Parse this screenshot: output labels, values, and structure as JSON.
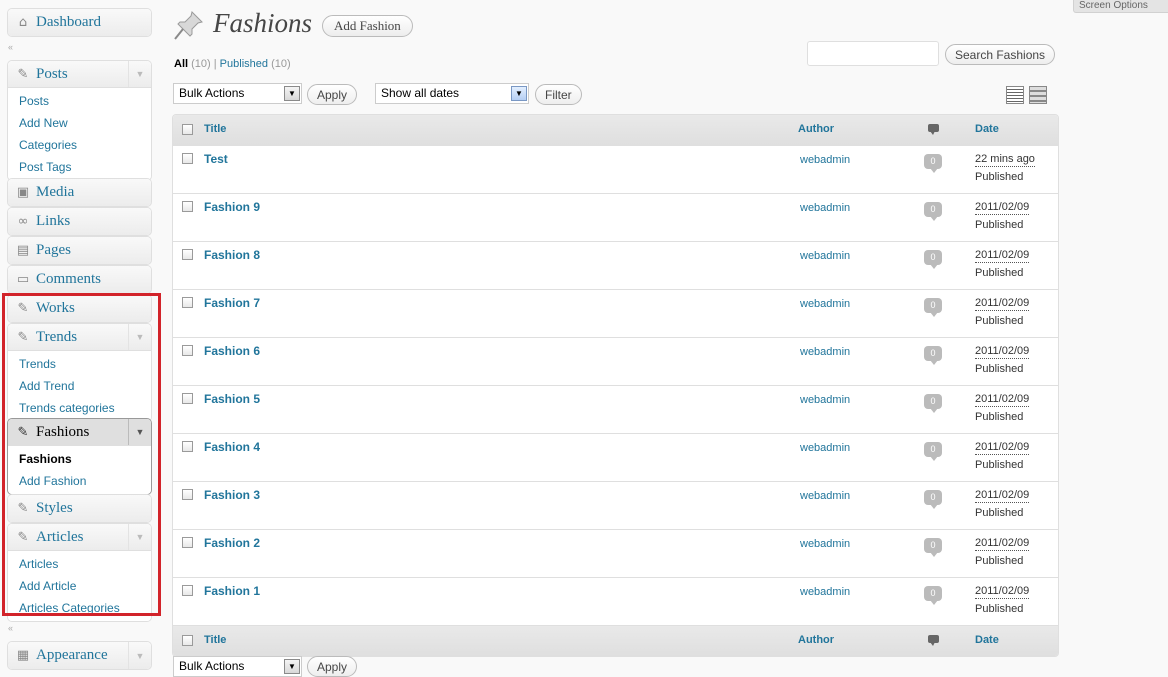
{
  "sidebar": {
    "dashboard": "Dashboard",
    "posts": {
      "label": "Posts",
      "items": [
        "Posts",
        "Add New",
        "Categories",
        "Post Tags"
      ]
    },
    "media": "Media",
    "links": "Links",
    "pages": "Pages",
    "comments": "Comments",
    "works": "Works",
    "trends": {
      "label": "Trends",
      "items": [
        "Trends",
        "Add Trend",
        "Trends categories"
      ]
    },
    "fashions": {
      "label": "Fashions",
      "items": [
        "Fashions",
        "Add Fashion"
      ]
    },
    "styles": "Styles",
    "articles": {
      "label": "Articles",
      "items": [
        "Articles",
        "Add Article",
        "Articles Categories"
      ]
    },
    "appearance": "Appearance",
    "collapse_glyph": "«"
  },
  "header": {
    "screen_options": "Screen Options",
    "title": "Fashions",
    "add_button": "Add Fashion",
    "search_button": "Search Fashions",
    "search_value": ""
  },
  "filters": {
    "all": "All",
    "all_count": "(10)",
    "sep": "|",
    "published": "Published",
    "published_count": "(10)",
    "bulk_actions": "Bulk Actions",
    "apply": "Apply",
    "dates": "Show all dates",
    "filter": "Filter"
  },
  "table": {
    "columns": {
      "title": "Title",
      "author": "Author",
      "date": "Date"
    },
    "rows": [
      {
        "title": "Test",
        "author": "webadmin",
        "comments": "0",
        "date": "22 mins ago",
        "status": "Published"
      },
      {
        "title": "Fashion 9",
        "author": "webadmin",
        "comments": "0",
        "date": "2011/02/09",
        "status": "Published"
      },
      {
        "title": "Fashion 8",
        "author": "webadmin",
        "comments": "0",
        "date": "2011/02/09",
        "status": "Published"
      },
      {
        "title": "Fashion 7",
        "author": "webadmin",
        "comments": "0",
        "date": "2011/02/09",
        "status": "Published"
      },
      {
        "title": "Fashion 6",
        "author": "webadmin",
        "comments": "0",
        "date": "2011/02/09",
        "status": "Published"
      },
      {
        "title": "Fashion 5",
        "author": "webadmin",
        "comments": "0",
        "date": "2011/02/09",
        "status": "Published"
      },
      {
        "title": "Fashion 4",
        "author": "webadmin",
        "comments": "0",
        "date": "2011/02/09",
        "status": "Published"
      },
      {
        "title": "Fashion 3",
        "author": "webadmin",
        "comments": "0",
        "date": "2011/02/09",
        "status": "Published"
      },
      {
        "title": "Fashion 2",
        "author": "webadmin",
        "comments": "0",
        "date": "2011/02/09",
        "status": "Published"
      },
      {
        "title": "Fashion 1",
        "author": "webadmin",
        "comments": "0",
        "date": "2011/02/09",
        "status": "Published"
      }
    ]
  },
  "colors": {
    "link": "#21759b",
    "highlight": "#d2232a"
  }
}
